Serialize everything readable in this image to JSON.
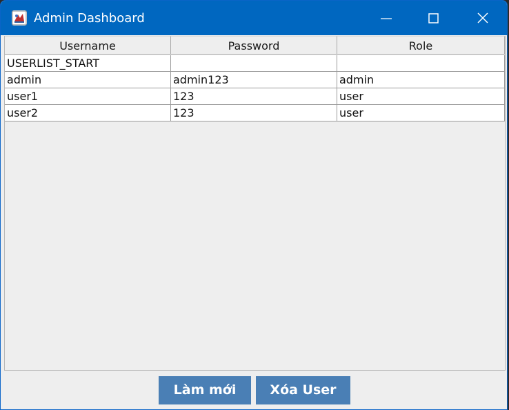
{
  "window": {
    "title": "Admin Dashboard",
    "titlebar_color": "#0067c0"
  },
  "table": {
    "columns": [
      "Username",
      "Password",
      "Role"
    ],
    "rows": [
      [
        "USERLIST_START",
        "",
        ""
      ],
      [
        "admin",
        "admin123",
        "admin"
      ],
      [
        "user1",
        "123",
        "user"
      ],
      [
        "user2",
        "123",
        "user"
      ]
    ]
  },
  "actions": {
    "refresh_label": "Làm mới",
    "delete_label": "Xóa User",
    "button_color": "#4a7fb5"
  }
}
